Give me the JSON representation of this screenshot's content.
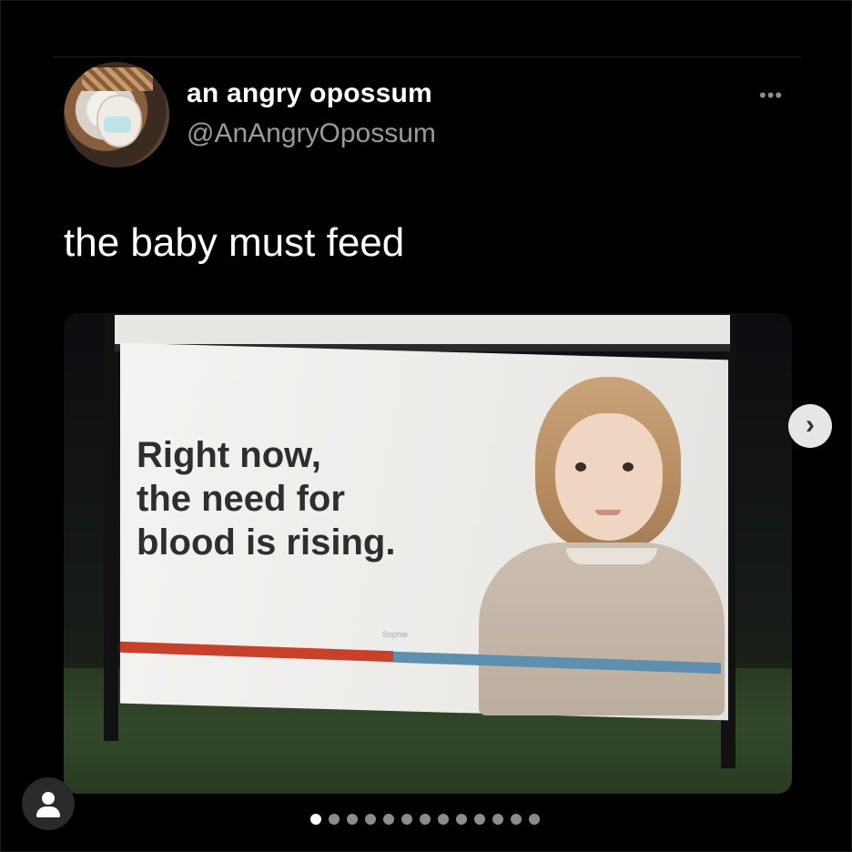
{
  "post": {
    "display_name": "an angry opossum",
    "handle": "@AnAngryOpossum",
    "more_icon": "ellipsis-icon",
    "text": "the baby must feed"
  },
  "media": {
    "sign_lines": [
      "Right now,",
      "the need for",
      "blood is rising."
    ],
    "fineprint": "Sophie",
    "next_icon": "chevron-right-icon"
  },
  "carousel": {
    "dot_count": 13,
    "active_index": 0
  },
  "icons": {
    "user": "user-icon"
  },
  "colors": {
    "background": "#000000",
    "handle": "#9a9a9a",
    "stripe_red": "#c8402a",
    "stripe_blue": "#5e8fae"
  }
}
